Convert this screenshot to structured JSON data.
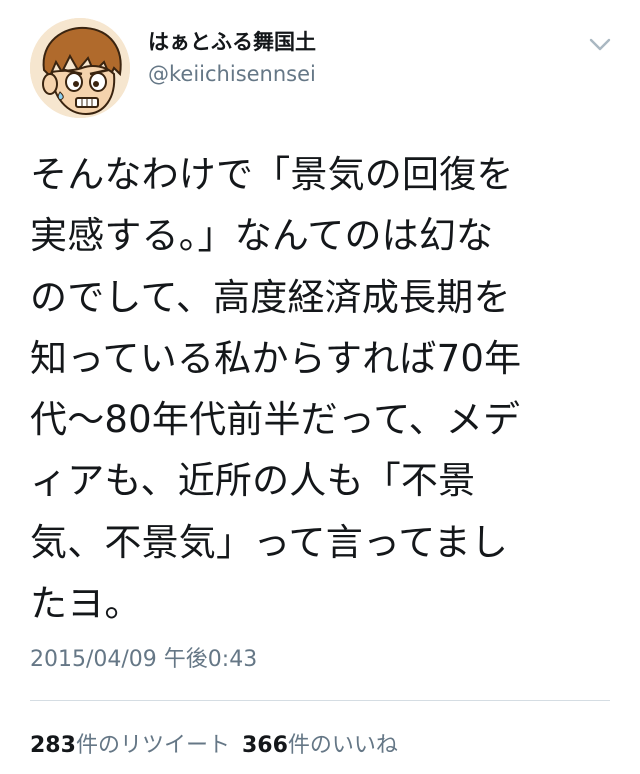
{
  "user": {
    "display_name": "はぁとふる舞国土",
    "handle": "@keiichisennsei"
  },
  "icons": {
    "menu": "chevron-down-icon",
    "avatar": "cartoon-avatar"
  },
  "tweet": {
    "text": "そんなわけで「景気の回復を\n実感する。」なんてのは幻な\nのでして、高度経済成長期を\n知っている私からすれば70年\n代〜80年代前半だって、メデ\nィアも、近所の人も「不景\n気、不景気」って言ってまし\nたヨ。",
    "timestamp": "2015/04/09 午後0:43"
  },
  "stats": {
    "retweet_count": "283",
    "retweet_label": "件のリツイート",
    "like_count": "366",
    "like_label": "件のいいね"
  },
  "colors": {
    "text": "#14171a",
    "secondary": "#657786",
    "divider": "#d5dde3"
  }
}
